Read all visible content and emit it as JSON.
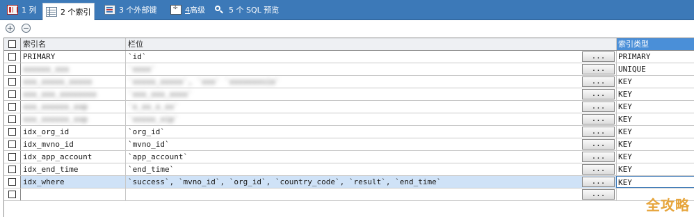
{
  "tabs": [
    {
      "num": "1",
      "label": "列",
      "icon": "columns-icon",
      "active": false
    },
    {
      "num": "2",
      "label": "个索引",
      "icon": "index-icon",
      "active": true
    },
    {
      "num": "3",
      "label": "个外部键",
      "icon": "foreign-key-icon",
      "active": false
    },
    {
      "num": "4",
      "label": "高级",
      "icon": "advanced-icon",
      "active": false
    },
    {
      "num": "5",
      "label": "个 SQL 预览",
      "icon": "sql-preview-icon",
      "active": false
    }
  ],
  "toolbar": {
    "add_icon": "add-circle-icon",
    "remove_icon": "remove-circle-icon"
  },
  "columns": {
    "name": "索引名",
    "fields": "栏位",
    "type": "索引类型"
  },
  "button_label": "...",
  "rows": [
    {
      "name": "PRIMARY",
      "fields": "`id`",
      "type": "PRIMARY",
      "obscured": false
    },
    {
      "name": "",
      "fields": "",
      "type": "UNIQUE",
      "obscured": true
    },
    {
      "name": "",
      "fields": "",
      "type": "KEY",
      "obscured": true
    },
    {
      "name": "",
      "fields": "",
      "type": "KEY",
      "obscured": true
    },
    {
      "name": "",
      "fields": "",
      "type": "KEY",
      "obscured": true
    },
    {
      "name": "",
      "fields": "",
      "type": "KEY",
      "obscured": true
    },
    {
      "name": "idx_org_id",
      "fields": "`org_id`",
      "type": "KEY",
      "obscured": false
    },
    {
      "name": "idx_mvno_id",
      "fields": "`mvno_id`",
      "type": "KEY",
      "obscured": false
    },
    {
      "name": "idx_app_account",
      "fields": "`app_account`",
      "type": "KEY",
      "obscured": false
    },
    {
      "name": "idx_end_time",
      "fields": "`end_time`",
      "type": "KEY",
      "obscured": false
    },
    {
      "name": "idx_where",
      "fields": "`success`, `mvno_id`, `org_id`, `country_code`, `result`, `end_time`",
      "type": "KEY",
      "obscured": false,
      "selected": true
    },
    {
      "name": "",
      "fields": "",
      "type": "",
      "obscured": false
    }
  ],
  "watermark": "全攻略",
  "colors": {
    "tabbar": "#3c79b8",
    "selected_row": "#cfe2f7",
    "header_highlight": "#4a8fd8"
  }
}
